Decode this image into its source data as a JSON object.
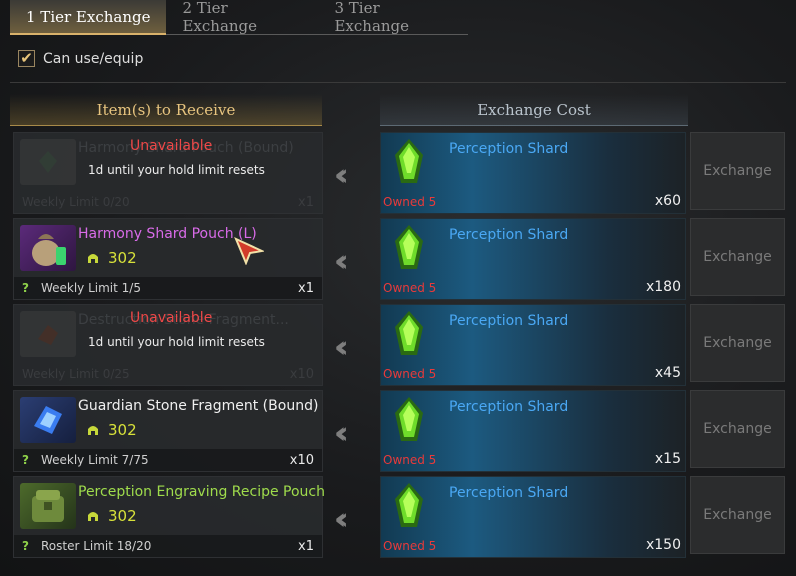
{
  "tabs": [
    {
      "label": "1 Tier Exchange",
      "active": true
    },
    {
      "label": "2 Tier Exchange",
      "active": false
    },
    {
      "label": "3 Tier Exchange",
      "active": false
    }
  ],
  "filter": {
    "can_use_label": "Can use/equip",
    "checked": true
  },
  "headers": {
    "receive": "Item(s) to Receive",
    "cost": "Exchange Cost"
  },
  "exchange_button_label": "Exchange",
  "rows": [
    {
      "available": false,
      "item_name": "Harmony Shard Pouch (Bound)",
      "unavailable_title": "Unavailable",
      "unavailable_sub": "1d until your hold limit resets",
      "limit_text": "Weekly Limit 0/20",
      "qty": "x1",
      "cost_item": "Perception Shard",
      "owned": "Owned 5",
      "cost_qty": "x60"
    },
    {
      "available": true,
      "item_name": "Harmony Shard Pouch (L)",
      "item_level": "302",
      "limit_text": "Weekly Limit 1/5",
      "qty": "x1",
      "cost_item": "Perception Shard",
      "owned": "Owned 5",
      "cost_qty": "x180"
    },
    {
      "available": false,
      "item_name": "Destruction Stone Fragment...",
      "unavailable_title": "Unavailable",
      "unavailable_sub": "1d until your hold limit resets",
      "limit_text": "Weekly Limit 0/25",
      "qty": "x10",
      "cost_item": "Perception Shard",
      "owned": "Owned 5",
      "cost_qty": "x45"
    },
    {
      "available": true,
      "item_name": "Guardian Stone Fragment (Bound)",
      "item_level": "302",
      "limit_text": "Weekly Limit 7/75",
      "qty": "x10",
      "cost_item": "Perception Shard",
      "owned": "Owned 5",
      "cost_qty": "x15"
    },
    {
      "available": true,
      "item_name": "Perception Engraving Recipe Pouch",
      "item_level": "302",
      "limit_text": "Roster Limit 18/20",
      "qty": "x1",
      "cost_item": "Perception Shard",
      "owned": "Owned 5",
      "cost_qty": "x150"
    }
  ],
  "icons": {
    "checkbox": "check-icon",
    "arrow": "double-chevron-left-icon",
    "level": "helmet-icon",
    "help": "question-icon",
    "shard": "perception-shard-icon"
  },
  "colors": {
    "accent_gold": "#e7c47f",
    "unavailable_red": "#ef4848",
    "owned_red": "#e83a3a",
    "cost_name_blue": "#4aa8f4",
    "item_level_yellow": "#d7e13a"
  }
}
